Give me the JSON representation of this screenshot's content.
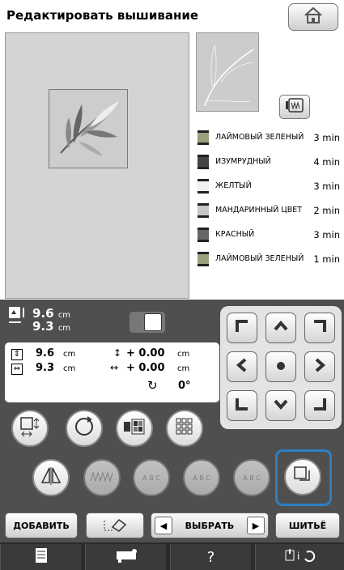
{
  "header": {
    "title": "Редактировать вышивание"
  },
  "colors": [
    {
      "name": "ЛАЙМОВЫЙ ЗЕЛЕНЫЙ",
      "time": "3 min"
    },
    {
      "name": "ИЗУМРУДНЫЙ",
      "time": "4 min"
    },
    {
      "name": "ЖЕЛТЫЙ",
      "time": "3 min"
    },
    {
      "name": "МАНДАРИННЫЙ ЦВЕТ",
      "time": "2 min"
    },
    {
      "name": "КРАСНЫЙ",
      "time": "3 min"
    },
    {
      "name": "ЛАЙМОВЫЙ ЗЕЛЕНЫЙ",
      "time": "1 min"
    }
  ],
  "size": {
    "w": "9.6",
    "h": "9.3",
    "unit": "cm"
  },
  "edit": {
    "h_size": "9.6",
    "w_size": "9.3",
    "unit": "cm",
    "offset_v": "+ 0.00",
    "offset_h": "+ 0.00",
    "offset_unit": "cm",
    "angle": "0°"
  },
  "buttons": {
    "add": "ДОБАВИТЬ",
    "select": "ВЫБРАТЬ",
    "sew": "ШИТЬЁ",
    "help": "?"
  },
  "abc": [
    "A B C",
    "A B C",
    "A B C"
  ]
}
